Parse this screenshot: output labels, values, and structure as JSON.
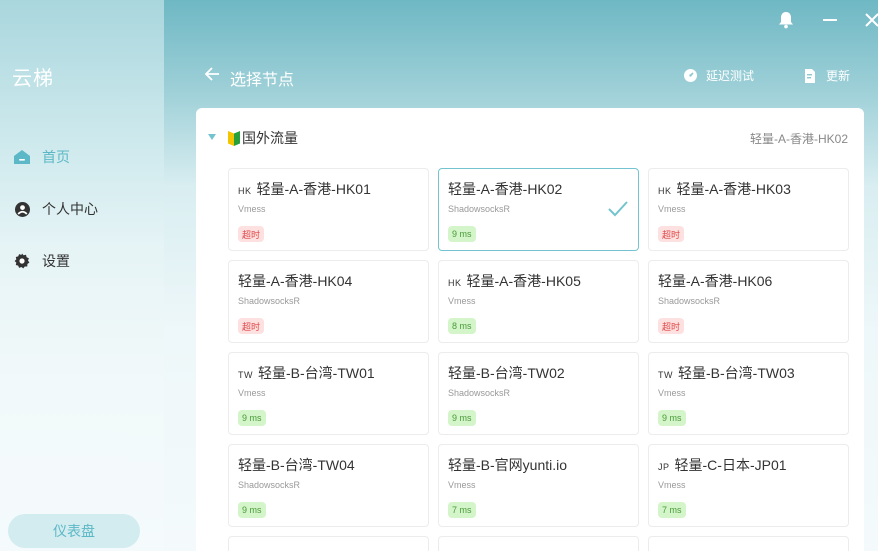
{
  "app": {
    "title": "云梯"
  },
  "sidebar": {
    "items": [
      {
        "label": "首页",
        "icon": "home-icon",
        "active": true
      },
      {
        "label": "个人中心",
        "icon": "user-icon",
        "active": false
      },
      {
        "label": "设置",
        "icon": "gear-icon",
        "active": false
      }
    ],
    "dashboard_label": "仪表盘"
  },
  "header": {
    "title": "选择节点",
    "latency_test_label": "延迟测试",
    "update_label": "更新"
  },
  "group": {
    "name": "国外流量",
    "selected_node": "轻量-A-香港-HK02"
  },
  "nodes": [
    {
      "flag": "HK",
      "name": "轻量-A-香港-HK01",
      "protocol": "Vmess",
      "latency": "超时",
      "status": "timeout",
      "selected": false
    },
    {
      "flag": "",
      "name": "轻量-A-香港-HK02",
      "protocol": "ShadowsocksR",
      "latency": "9 ms",
      "status": "ok",
      "selected": true
    },
    {
      "flag": "HK",
      "name": "轻量-A-香港-HK03",
      "protocol": "Vmess",
      "latency": "超时",
      "status": "timeout",
      "selected": false
    },
    {
      "flag": "",
      "name": "轻量-A-香港-HK04",
      "protocol": "ShadowsocksR",
      "latency": "超时",
      "status": "timeout",
      "selected": false
    },
    {
      "flag": "HK",
      "name": "轻量-A-香港-HK05",
      "protocol": "Vmess",
      "latency": "8 ms",
      "status": "ok",
      "selected": false
    },
    {
      "flag": "",
      "name": "轻量-A-香港-HK06",
      "protocol": "ShadowsocksR",
      "latency": "超时",
      "status": "timeout",
      "selected": false
    },
    {
      "flag": "TW",
      "name": "轻量-B-台湾-TW01",
      "protocol": "Vmess",
      "latency": "9 ms",
      "status": "ok",
      "selected": false
    },
    {
      "flag": "",
      "name": "轻量-B-台湾-TW02",
      "protocol": "ShadowsocksR",
      "latency": "9 ms",
      "status": "ok",
      "selected": false
    },
    {
      "flag": "TW",
      "name": "轻量-B-台湾-TW03",
      "protocol": "Vmess",
      "latency": "9 ms",
      "status": "ok",
      "selected": false
    },
    {
      "flag": "",
      "name": "轻量-B-台湾-TW04",
      "protocol": "ShadowsocksR",
      "latency": "9 ms",
      "status": "ok",
      "selected": false
    },
    {
      "flag": "",
      "name": "轻量-B-官网yunti.io",
      "protocol": "Vmess",
      "latency": "7 ms",
      "status": "ok",
      "selected": false
    },
    {
      "flag": "JP",
      "name": "轻量-C-日本-JP01",
      "protocol": "Vmess",
      "latency": "7 ms",
      "status": "ok",
      "selected": false
    }
  ],
  "colors": {
    "accent": "#5cb8c6",
    "ok_bg": "#d4f5c9",
    "ok_text": "#4a9a3a",
    "timeout_bg": "#fde0e0",
    "timeout_text": "#e04848"
  }
}
